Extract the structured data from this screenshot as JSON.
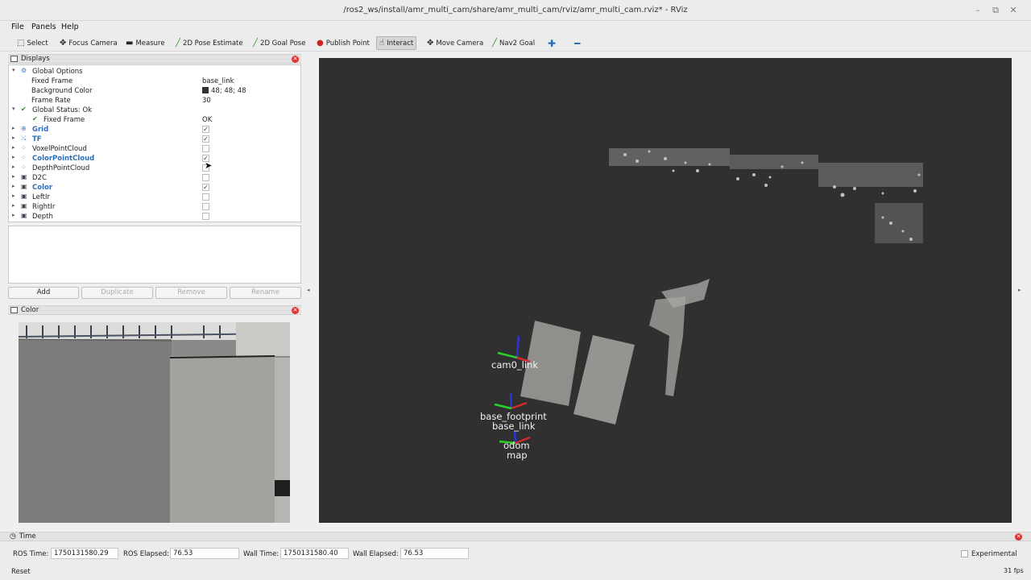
{
  "window": {
    "title": "/ros2_ws/install/amr_multi_cam/share/amr_multi_cam/rviz/amr_multi_cam.rviz* - RViz"
  },
  "menu": [
    "File",
    "Panels",
    "Help"
  ],
  "toolbar": [
    {
      "label": "Select",
      "icon": "select-icon"
    },
    {
      "label": "Focus Camera",
      "icon": "focus-camera-icon"
    },
    {
      "label": "Measure",
      "icon": "measure-icon"
    },
    {
      "label": "2D Pose Estimate",
      "icon": "pose-estimate-icon"
    },
    {
      "label": "2D Goal Pose",
      "icon": "goal-pose-icon"
    },
    {
      "label": "Publish Point",
      "icon": "publish-point-icon"
    },
    {
      "label": "Interact",
      "icon": "interact-icon",
      "active": true
    },
    {
      "label": "Move Camera",
      "icon": "move-camera-icon"
    },
    {
      "label": "Nav2 Goal",
      "icon": "nav2-goal-icon"
    }
  ],
  "displays": {
    "title": "Displays",
    "rows": [
      {
        "label": "Global Options",
        "value": ""
      },
      {
        "label": "Fixed Frame",
        "value": "base_link"
      },
      {
        "label": "Background Color",
        "value": "48; 48; 48"
      },
      {
        "label": "Frame Rate",
        "value": "30"
      },
      {
        "label": "Global Status: Ok",
        "value": ""
      },
      {
        "label": "Fixed Frame",
        "value": "OK"
      },
      {
        "label": "Grid",
        "checked": true
      },
      {
        "label": "TF",
        "checked": true
      },
      {
        "label": "VoxelPointCloud",
        "checked": false
      },
      {
        "label": "ColorPointCloud",
        "checked": true
      },
      {
        "label": "DepthPointCloud",
        "checked": false
      },
      {
        "label": "D2C",
        "checked": false
      },
      {
        "label": "Color",
        "checked": true
      },
      {
        "label": "LeftIr",
        "checked": false
      },
      {
        "label": "RightIr",
        "checked": false
      },
      {
        "label": "Depth",
        "checked": false
      }
    ],
    "buttons": [
      "Add",
      "Duplicate",
      "Remove",
      "Rename"
    ]
  },
  "color_panel": {
    "title": "Color"
  },
  "view3d": {
    "tf_frames": [
      "cam0_link",
      "base_footprint",
      "base_link",
      "odom",
      "map"
    ]
  },
  "time": {
    "title": "Time",
    "ros_time_label": "ROS Time:",
    "ros_time": "1750131580.29",
    "ros_elapsed_label": "ROS Elapsed:",
    "ros_elapsed": "76.53",
    "wall_time_label": "Wall Time:",
    "wall_time": "1750131580.40",
    "wall_elapsed_label": "Wall Elapsed:",
    "wall_elapsed": "76.53",
    "experimental_label": "Experimental",
    "reset_label": "Reset",
    "fps": "31 fps"
  },
  "colors": {
    "background": "#303030",
    "accent_blue": "#2a6fbd"
  }
}
